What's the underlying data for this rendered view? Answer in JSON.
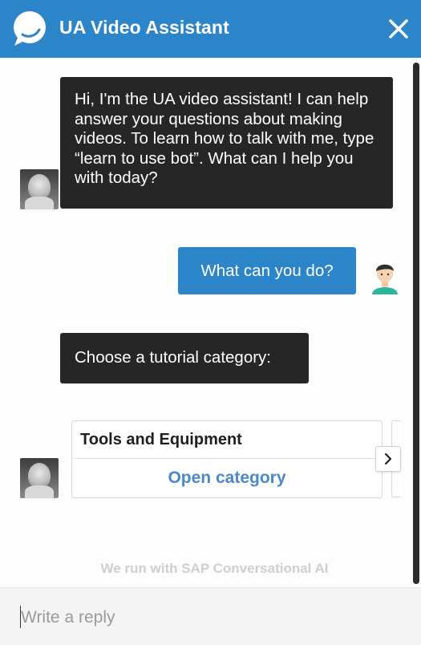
{
  "header": {
    "title": "UA Video Assistant",
    "logo_icon": "chat-bubble-icon",
    "close_icon": "close-icon",
    "color": "#2c85c8"
  },
  "messages": [
    {
      "sender": "bot",
      "text": "Hi, I'm the UA video assistant! I can help answer your questions about making videos. To learn how to talk with me, type “learn to use bot”. What can I help you with today?"
    },
    {
      "sender": "user",
      "text": "What can you do?"
    },
    {
      "sender": "bot",
      "text": "Choose a tutorial category:"
    }
  ],
  "carousel": {
    "cards": [
      {
        "title": "Tools and Equipment",
        "action": "Open category"
      }
    ],
    "next_icon": "chevron-right-icon"
  },
  "powered_by": "We run with SAP Conversational AI",
  "composer": {
    "placeholder": "Write a reply"
  },
  "colors": {
    "bot_bubble": "#262626",
    "user_bubble": "#2c85c8",
    "action_link": "#4b88c8"
  }
}
